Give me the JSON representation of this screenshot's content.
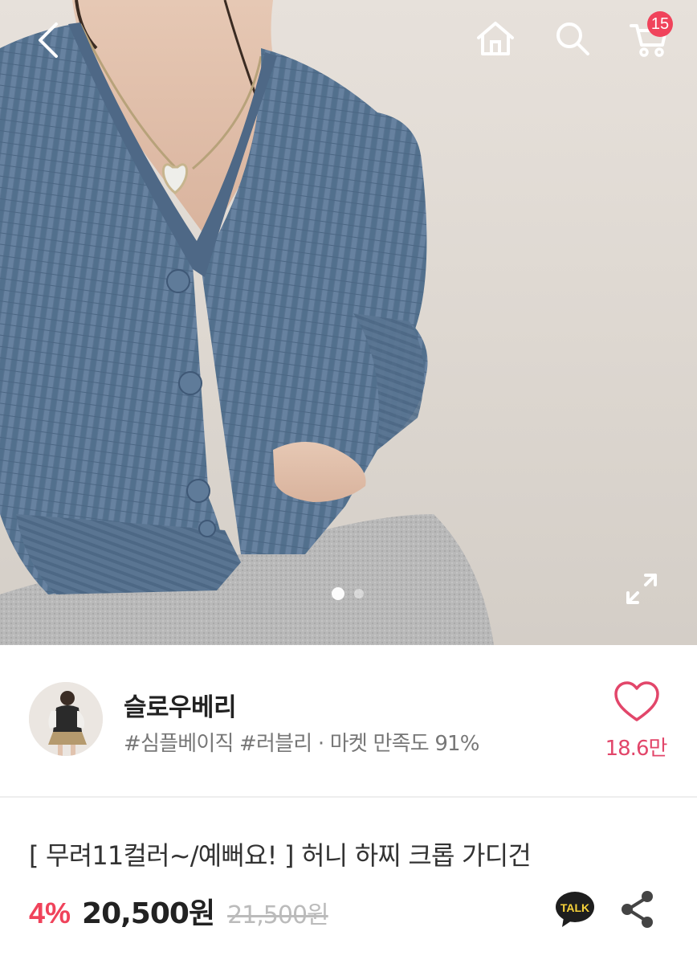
{
  "topbar": {
    "back_icon": "chevron-left-icon",
    "home_icon": "home-icon",
    "search_icon": "search-icon",
    "cart_icon": "cart-icon",
    "cart_count": "15"
  },
  "gallery": {
    "current_page": 1,
    "total_pages": 2,
    "expand_icon": "expand-icon"
  },
  "shop": {
    "name": "슬로우베리",
    "tags": "#심플베이직 #러블리 · 마켓 만족도 91%",
    "like_icon": "heart-icon",
    "like_count": "18.6만"
  },
  "product": {
    "title": "[ 무려11컬러~/예뻐요! ] 허니 하찌 크롭 가디건",
    "discount": "4%",
    "price": "20,500원",
    "original_price": "21,500원",
    "kakao_label": "TALK",
    "share_icon": "share-icon"
  },
  "colors": {
    "accent": "#f0435b",
    "like": "#e2466a",
    "sweater": "#5b7593"
  }
}
